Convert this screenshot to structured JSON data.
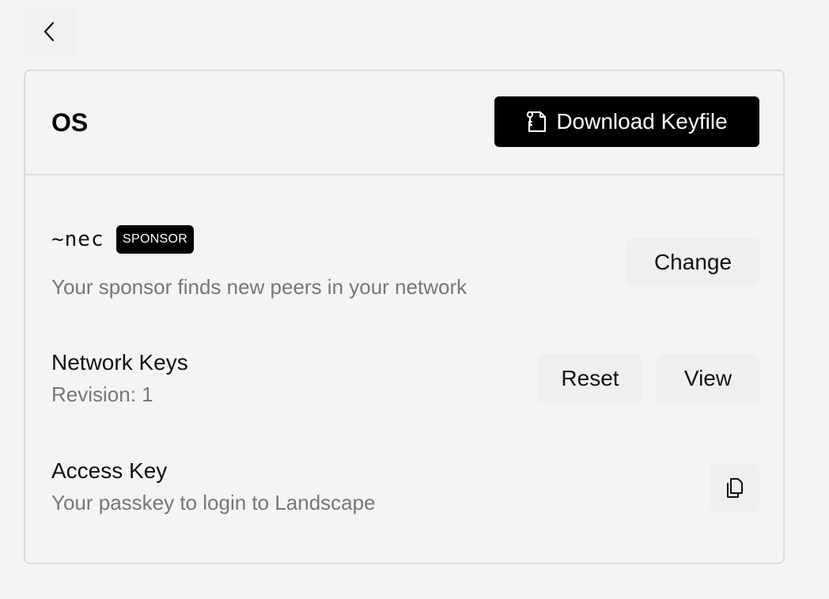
{
  "nav": {
    "back_icon": "chevron-left-icon"
  },
  "card": {
    "title": "OS",
    "download_button": {
      "label": "Download Keyfile",
      "icon": "keyfile-icon"
    }
  },
  "sponsor": {
    "ship": "~nec",
    "badge": "SPONSOR",
    "description": "Your sponsor finds new peers in your network",
    "change_label": "Change"
  },
  "network_keys": {
    "title": "Network Keys",
    "revision": "Revision: 1",
    "reset_label": "Reset",
    "view_label": "View"
  },
  "access_key": {
    "title": "Access Key",
    "description": "Your passkey to login to Landscape",
    "copy_icon": "copy-icon"
  }
}
